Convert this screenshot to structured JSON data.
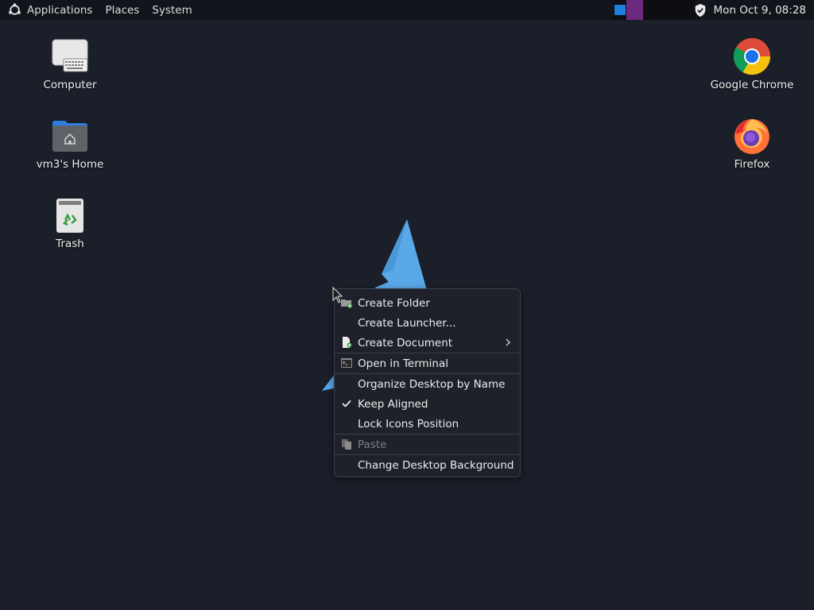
{
  "panel": {
    "apps_label": "Applications",
    "places_label": "Places",
    "system_label": "System",
    "clock": "Mon Oct  9, 08:28"
  },
  "desktop": {
    "left_icons": [
      {
        "label": "Computer",
        "icon": "computer-icon"
      },
      {
        "label": "vm3's Home",
        "icon": "home-folder-icon"
      },
      {
        "label": "Trash",
        "icon": "trash-icon"
      }
    ],
    "right_icons": [
      {
        "label": "Google Chrome",
        "icon": "chrome-icon"
      },
      {
        "label": "Firefox",
        "icon": "firefox-icon"
      }
    ]
  },
  "context_menu": {
    "items": [
      {
        "label": "Create Folder",
        "icon": "folder-add-icon"
      },
      {
        "label": "Create Launcher...",
        "icon": null
      },
      {
        "label": "Create Document",
        "icon": "document-add-icon",
        "submenu": true
      },
      {
        "label": "Open in Terminal",
        "icon": "terminal-icon"
      },
      {
        "label": "Organize Desktop by Name",
        "icon": null
      },
      {
        "label": "Keep Aligned",
        "icon": "check-icon",
        "checked": true
      },
      {
        "label": "Lock Icons Position",
        "icon": null
      },
      {
        "label": "Paste",
        "icon": "paste-icon",
        "disabled": true
      },
      {
        "label": "Change Desktop Background",
        "icon": null
      }
    ]
  },
  "colors": {
    "desktop_bg": "#1a1f29",
    "panel_bg": "#11141a",
    "menu_bg": "#1e2129",
    "accent_blue": "#5aa8e8"
  }
}
